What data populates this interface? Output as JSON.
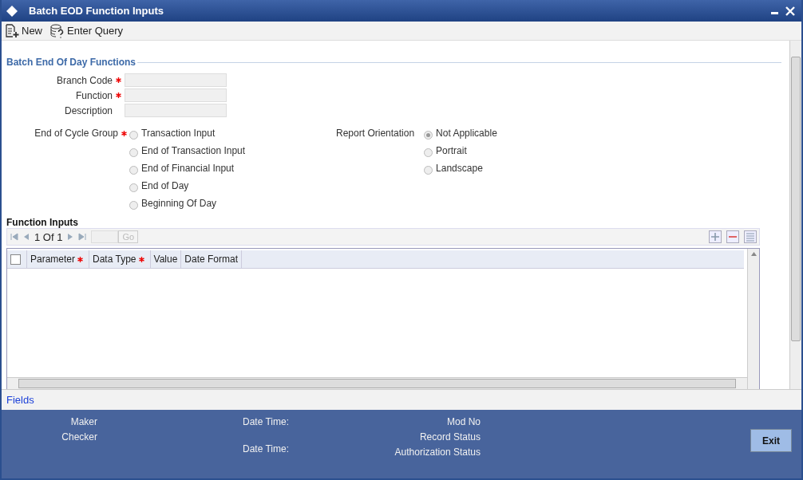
{
  "window": {
    "title": "Batch EOD Function Inputs"
  },
  "toolbar": [
    {
      "kind": "new",
      "label": "New"
    },
    {
      "kind": "query",
      "label": "Enter Query"
    }
  ],
  "section": {
    "title": "Batch End Of Day Functions"
  },
  "fields": [
    {
      "label": "Branch Code",
      "required": true
    },
    {
      "label": "Function",
      "required": true
    },
    {
      "label": "Description",
      "required": false
    }
  ],
  "end_of_cycle_group": {
    "label": "End of Cycle Group",
    "required": true,
    "options": [
      {
        "label": "Transaction Input",
        "selected": false
      },
      {
        "label": "End of Transaction Input",
        "selected": false
      },
      {
        "label": "End of Financial Input",
        "selected": false
      },
      {
        "label": "End of Day",
        "selected": false
      },
      {
        "label": "Beginning Of Day",
        "selected": false
      }
    ]
  },
  "report_orientation": {
    "label": "Report Orientation",
    "options": [
      {
        "label": "Not Applicable",
        "selected": true
      },
      {
        "label": "Portrait",
        "selected": false
      },
      {
        "label": "Landscape",
        "selected": false
      }
    ]
  },
  "function_inputs": {
    "title": "Function Inputs",
    "page_text": "1 Of 1",
    "go": "Go",
    "select_all_checked": false,
    "columns": [
      {
        "label": "Parameter",
        "required": true
      },
      {
        "label": "Data Type",
        "required": true
      },
      {
        "label": "Value",
        "required": false
      },
      {
        "label": "Date Format",
        "required": false
      }
    ]
  },
  "fields_link": "Fields",
  "footer": {
    "maker": "Maker",
    "checker": "Checker",
    "date_time_1": "Date Time:",
    "date_time_2": "Date Time:",
    "mod_no": "Mod No",
    "record_status": "Record Status",
    "authorization_status": "Authorization Status",
    "exit": "Exit"
  }
}
